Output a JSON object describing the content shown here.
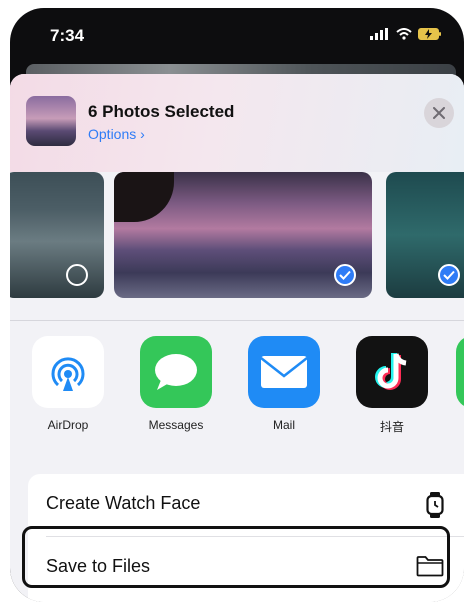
{
  "status_bar": {
    "time": "7:34"
  },
  "share_header": {
    "title": "6 Photos Selected",
    "options_label": "Options",
    "options_chevron": "›"
  },
  "photos": [
    {
      "selected": false
    },
    {
      "selected": true
    },
    {
      "selected": true
    }
  ],
  "apps": [
    {
      "label": "AirDrop",
      "icon": "airdrop-icon"
    },
    {
      "label": "Messages",
      "icon": "messages-icon"
    },
    {
      "label": "Mail",
      "icon": "mail-icon"
    },
    {
      "label": "抖音",
      "icon": "douyin-icon"
    }
  ],
  "actions": [
    {
      "label": "Create Watch Face",
      "icon": "watch-icon"
    },
    {
      "label": "Save to Files",
      "icon": "folder-icon"
    }
  ],
  "colors": {
    "accent": "#2f7cf6",
    "messages_green": "#34c759",
    "mail_blue": "#1f8bf5"
  }
}
